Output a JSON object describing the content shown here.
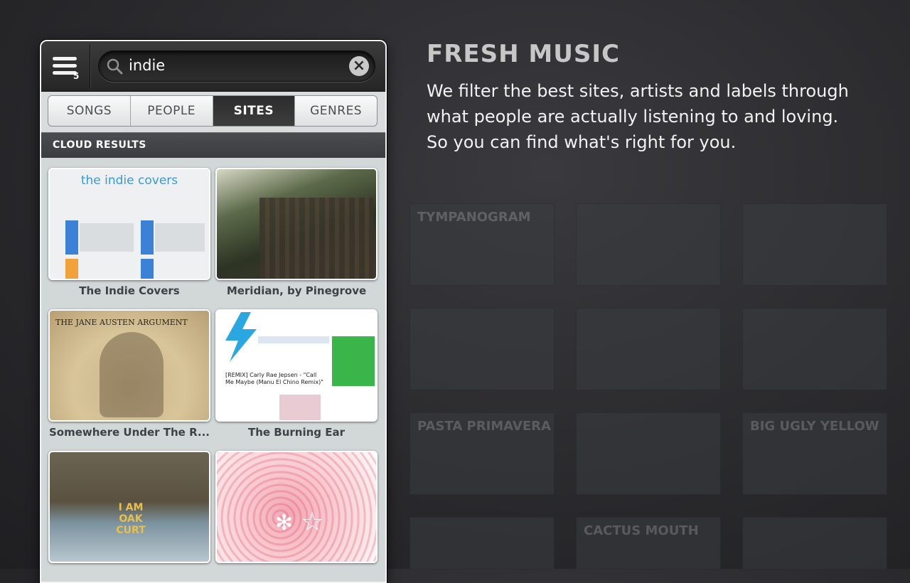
{
  "search": {
    "value": "indie",
    "menu_count": "5"
  },
  "tabs": [
    {
      "label": "SONGS"
    },
    {
      "label": "PEOPLE"
    },
    {
      "label": "SITES"
    },
    {
      "label": "GENRES"
    }
  ],
  "active_tab": "SITES",
  "section": {
    "title": "CLOUD RESULTS"
  },
  "results": [
    {
      "caption": "The Indie Covers",
      "thumb_text": "the indie covers"
    },
    {
      "caption": "Meridian, by Pinegrove"
    },
    {
      "caption": "Somewhere Under The R...",
      "thumb_text": "THE JANE AUSTEN ARGUMENT"
    },
    {
      "caption": "The Burning Ear",
      "thumb_text": "[REMIX] Carly Rae Jepsen - \"Call Me Maybe (Manu El Chino Remix)\""
    },
    {
      "caption": "",
      "thumb_text": "I AM OAK CURT"
    },
    {
      "caption": ""
    }
  ],
  "promo": {
    "headline": "FRESH MUSIC",
    "lines": [
      "We filter the best sites, artists and labels through",
      "what people are actually listening to and loving.",
      "So you can find what's right for you."
    ]
  },
  "background_sites": [
    "TYMPANOGRAM",
    "",
    "",
    "",
    "",
    "",
    "PASTA PRIMAVERA",
    "",
    "BIG UGLY YELLOW",
    "",
    "CACTUS MOUTH",
    ""
  ]
}
